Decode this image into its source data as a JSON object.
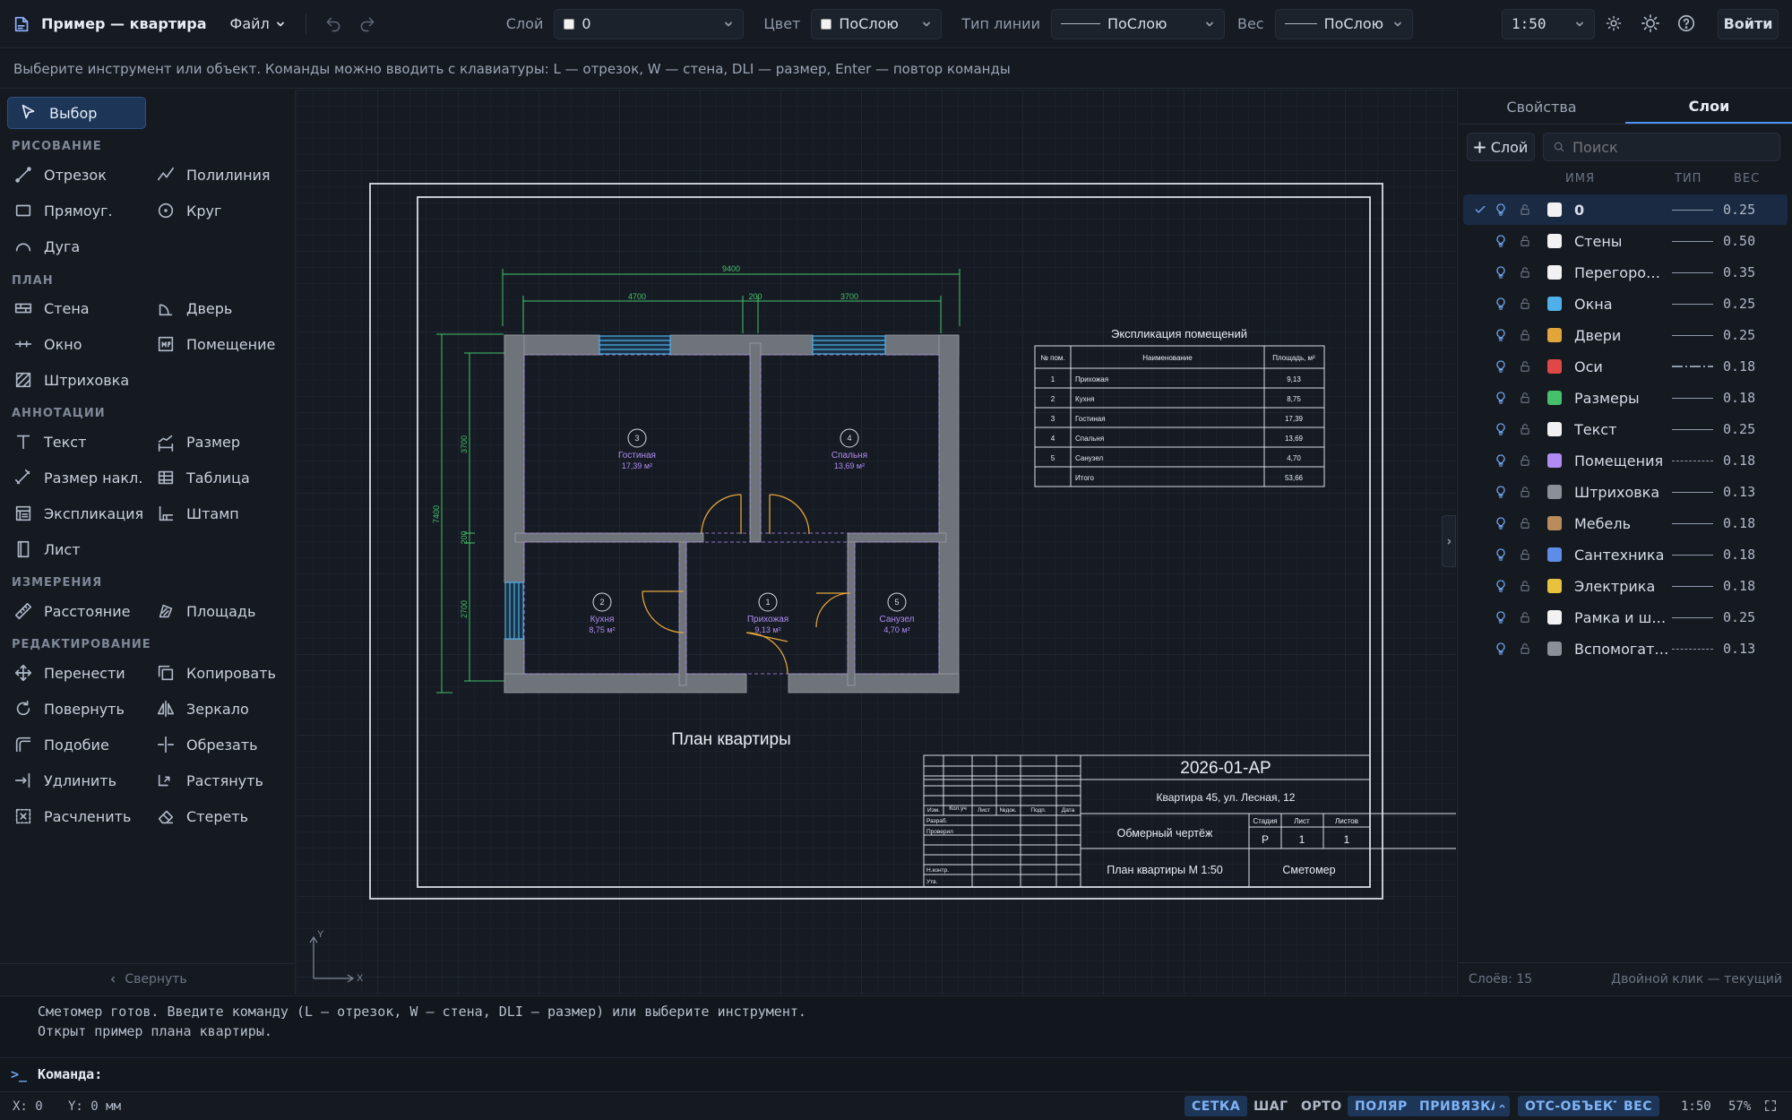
{
  "app": {
    "title": "Пример — квартира",
    "menu_file": "Файл",
    "login": "Войти",
    "scale": "1:50"
  },
  "toolbar": {
    "layer_label": "Слой",
    "layer_value": "0",
    "color_label": "Цвет",
    "color_value": "ПоСлою",
    "linetype_label": "Тип линии",
    "linetype_value": "ПоСлою",
    "weight_label": "Вес",
    "weight_value": "ПоСлою"
  },
  "hint": "Выберите инструмент или объект. Команды можно вводить с клавиатуры: L — отрезок, W — стена, DLI — размер, Enter — повтор команды",
  "tools": {
    "select": "Выбор",
    "sec_draw": "РИСОВАНИЕ",
    "line": "Отрезок",
    "polyline": "Полилиния",
    "rect": "Прямоуг.",
    "circle": "Круг",
    "arc": "Дуга",
    "sec_plan": "ПЛАН",
    "wall": "Стена",
    "door": "Дверь",
    "window": "Окно",
    "room": "Помещение",
    "hatch": "Штриховка",
    "sec_annot": "АННОТАЦИИ",
    "text": "Текст",
    "dim": "Размер",
    "dim_aligned": "Размер накл.",
    "table": "Таблица",
    "explication": "Экспликация",
    "stamp": "Штамп",
    "sheet": "Лист",
    "sec_measure": "ИЗМЕРЕНИЯ",
    "distance": "Расстояние",
    "area": "Площадь",
    "sec_edit": "РЕДАКТИРОВАНИЕ",
    "move": "Перенести",
    "copy": "Копировать",
    "rotate": "Повернуть",
    "mirror": "Зеркало",
    "offset": "Подобие",
    "trim": "Обрезать",
    "extend": "Удлинить",
    "stretch": "Растянуть",
    "explode": "Расчленить",
    "erase": "Стереть",
    "collapse": "Свернуть"
  },
  "drawing": {
    "dims": {
      "total": "9400",
      "d1": "4700",
      "d2": "200",
      "d3": "3700",
      "v_total": "7400",
      "v1": "3700",
      "v2": "200",
      "v3": "2700"
    },
    "rooms": [
      {
        "num": "3",
        "name": "Гостиная",
        "area": "17,39 м²"
      },
      {
        "num": "4",
        "name": "Спальня",
        "area": "13,69 м²"
      },
      {
        "num": "2",
        "name": "Кухня",
        "area": "8,75 м²"
      },
      {
        "num": "1",
        "name": "Прихожая",
        "area": "9,13 м²"
      },
      {
        "num": "5",
        "name": "Санузел",
        "area": "4,70 м²"
      }
    ],
    "plan_title": "План квартиры",
    "expl": {
      "title": "Экспликация помещений",
      "headers": [
        "№ пом.",
        "Наименование",
        "Площадь, м²"
      ],
      "rows": [
        [
          "1",
          "Прихожая",
          "9,13"
        ],
        [
          "2",
          "Кухня",
          "8,75"
        ],
        [
          "3",
          "Гостиная",
          "17,39"
        ],
        [
          "4",
          "Спальня",
          "13,69"
        ],
        [
          "5",
          "Санузел",
          "4,70"
        ],
        [
          "",
          "Итого",
          "53,66"
        ]
      ]
    },
    "stamp": {
      "code": "2026-01-АР",
      "address": "Квартира 45, ул. Лесная, 12",
      "doc": "Обмерный чертёж",
      "sheet_title": "План квартиры М 1:50",
      "org": "Сметомер",
      "h_stage": "Стадия",
      "h_sheet": "Лист",
      "h_sheets": "Листов",
      "stage": "Р",
      "sheet": "1",
      "sheets": "1",
      "c_izm": "Изм.",
      "c_kol": "Кол.уч",
      "c_list": "Лист",
      "c_ndok": "№док.",
      "c_podp": "Подп.",
      "c_data": "Дата",
      "r_razrab": "Разраб.",
      "r_prov": "Проверил",
      "r_nkontr": "Н.контр.",
      "r_utv": "Утв."
    },
    "axis_x": "X",
    "axis_y": "Y"
  },
  "panel": {
    "tab_props": "Свойства",
    "tab_layers": "Слои",
    "add_layer": "Слой",
    "search_placeholder": "Поиск",
    "col_name": "ИМЯ",
    "col_type": "ТИП",
    "col_weight": "ВЕС",
    "layers": [
      {
        "name": "0",
        "color": "#f2f2f2",
        "type": "solid",
        "weight": "0.25"
      },
      {
        "name": "Стены",
        "color": "#f2f2f2",
        "type": "solid",
        "weight": "0.50"
      },
      {
        "name": "Перегородки",
        "color": "#f2f2f2",
        "type": "solid",
        "weight": "0.35"
      },
      {
        "name": "Окна",
        "color": "#4fb0ea",
        "type": "solid",
        "weight": "0.25"
      },
      {
        "name": "Двери",
        "color": "#e2a53a",
        "type": "solid",
        "weight": "0.25"
      },
      {
        "name": "Оси",
        "color": "#e04848",
        "type": "dashdot",
        "weight": "0.18"
      },
      {
        "name": "Размеры",
        "color": "#44c16a",
        "type": "solid",
        "weight": "0.18"
      },
      {
        "name": "Текст",
        "color": "#f2f2f2",
        "type": "solid",
        "weight": "0.25"
      },
      {
        "name": "Помещения",
        "color": "#b08cf2",
        "type": "dashed",
        "weight": "0.18"
      },
      {
        "name": "Штриховка",
        "color": "#8a8f98",
        "type": "solid",
        "weight": "0.13"
      },
      {
        "name": "Мебель",
        "color": "#b98b5d",
        "type": "solid",
        "weight": "0.18"
      },
      {
        "name": "Сантехника",
        "color": "#5d8de6",
        "type": "solid",
        "weight": "0.18"
      },
      {
        "name": "Электрика",
        "color": "#e6c23d",
        "type": "solid",
        "weight": "0.18"
      },
      {
        "name": "Рамка и шта...",
        "color": "#f2f2f2",
        "type": "solid",
        "weight": "0.25"
      },
      {
        "name": "Вспомогате...",
        "color": "#8a8f98",
        "type": "dashed",
        "weight": "0.13"
      }
    ],
    "footer_count": "Слоёв: 15",
    "footer_hint": "Двойной клик — текущий"
  },
  "console": {
    "line1": "Сметомер готов. Введите команду (L — отрезок, W — стена, DLI — размер) или выберите инструмент.",
    "line2": "Открыт пример плана квартиры.",
    "prompt": ">_",
    "label": "Команда:"
  },
  "status": {
    "x": "X: 0",
    "y": "Y: 0 мм",
    "grid": "СЕТКА",
    "snap": "ШАГ",
    "ortho": "ОРТО",
    "polar": "ПОЛЯР",
    "osnap": "ПРИВЯЗКА",
    "otrack": "ОТС-ОБЪЕКТ",
    "lweight": "ВЕС",
    "scale": "1:50",
    "zoom": "57%"
  },
  "colors": {
    "accent": "#4f93f0",
    "dim": "#44c16a",
    "door": "#e2a53a",
    "window": "#4fb0ea",
    "room": "#b08cf2",
    "wall": "#7b7e84"
  }
}
